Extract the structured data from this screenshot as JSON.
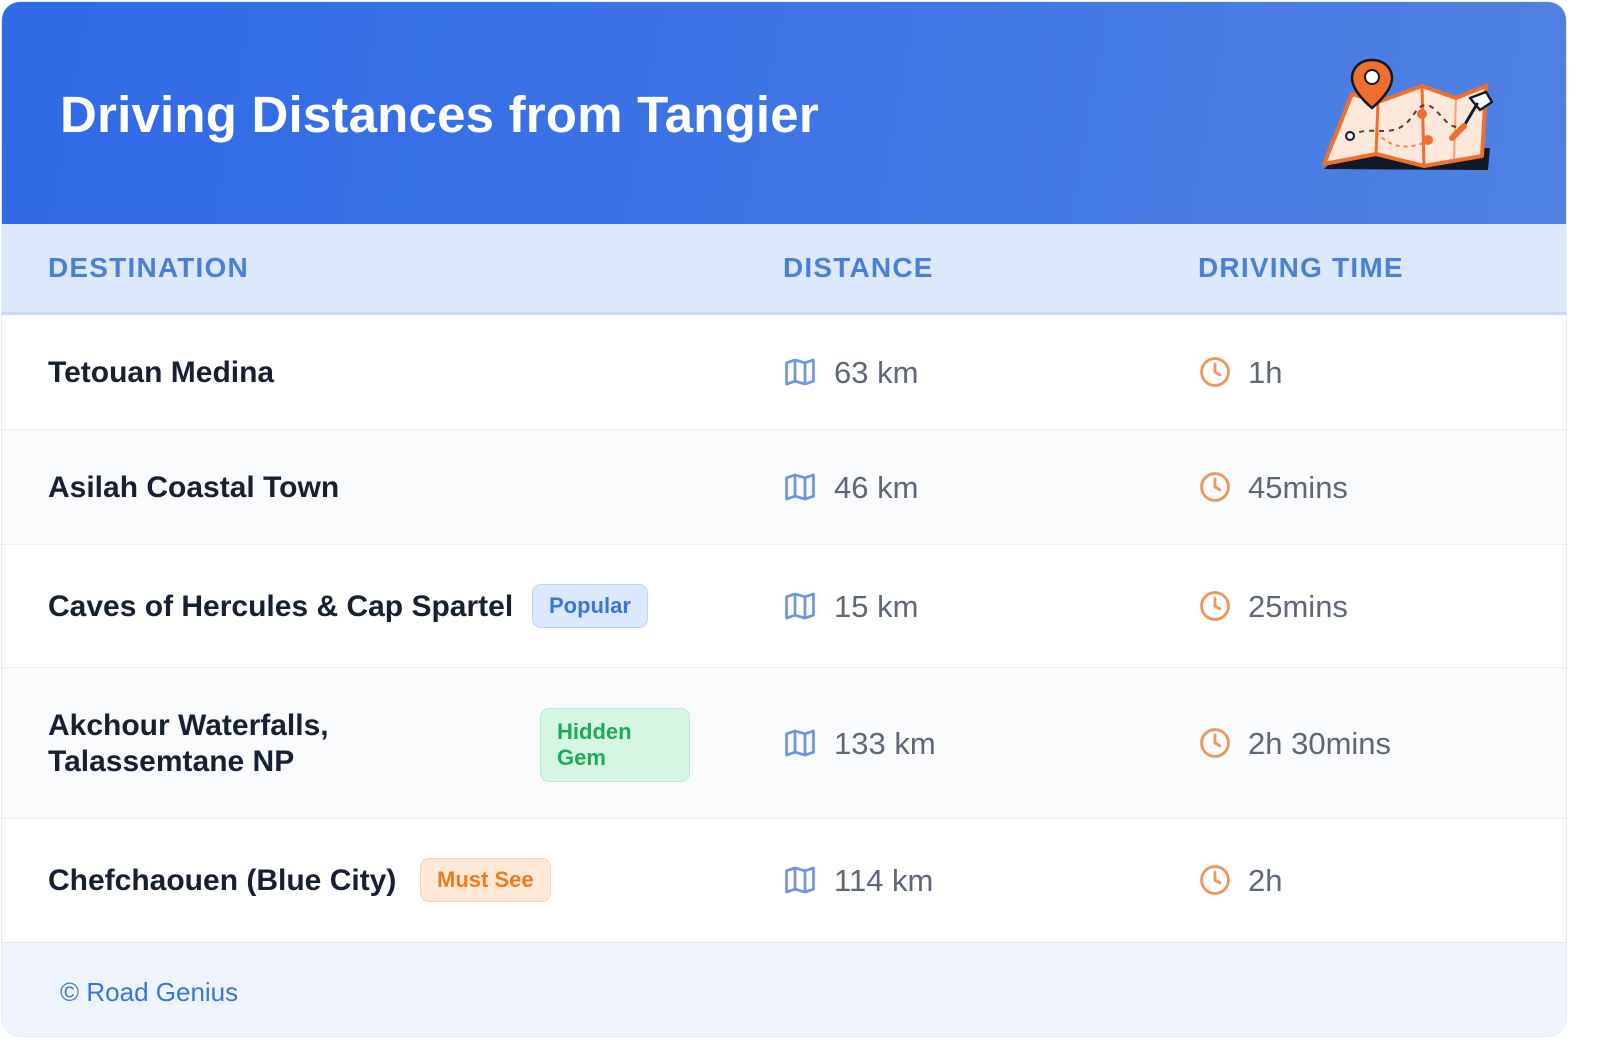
{
  "header": {
    "title": "Driving Distances from Tangier",
    "illustration_icon": "map-with-pins-icon",
    "gradient_colors": [
      "#2f6ae6",
      "#4f82e2"
    ]
  },
  "table": {
    "columns": [
      "DESTINATION",
      "DISTANCE",
      "DRIVING TIME"
    ],
    "distance_icon": "map-icon",
    "time_icon": "clock-icon",
    "rows": [
      {
        "destination": "Tetouan Medina",
        "distance": "63 km",
        "time": "1h",
        "badge": null
      },
      {
        "destination": "Asilah Coastal Town",
        "distance": "46 km",
        "time": "45mins",
        "badge": null
      },
      {
        "destination": "Caves of Hercules & Cap Spartel",
        "distance": "15 km",
        "time": "25mins",
        "badge": "Popular"
      },
      {
        "destination_lines": [
          "Akchour Waterfalls,",
          "Talassemtane NP"
        ],
        "distance": "133 km",
        "time": "2h 30mins",
        "badge_lines": [
          "Hidden",
          "Gem"
        ]
      },
      {
        "destination": "Chefchaouen (Blue City)",
        "distance": "114 km",
        "time": "2h",
        "badge": "Must See"
      }
    ]
  },
  "colors": {
    "header_blue": "#2f6ae6",
    "column_header_text": "#4b7fd6",
    "icon_blue": "#6f95dc",
    "icon_orange": "#ef955a",
    "badge_popular": "#3c75d8",
    "badge_hidden_gem": "#1faa5a",
    "badge_must_see": "#ec7a22"
  },
  "footer": {
    "credit": "© Road Genius"
  }
}
